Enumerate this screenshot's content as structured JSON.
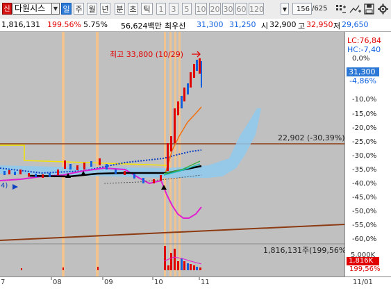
{
  "toolbar": {
    "badge": "신",
    "stock_name": "다원시스",
    "periods": [
      "일",
      "주",
      "월",
      "년",
      "분",
      "초",
      "틱"
    ],
    "active_period": "일",
    "intervals": [
      "1",
      "3",
      "5",
      "10",
      "20",
      "30",
      "60",
      "120"
    ],
    "count_value": "156",
    "count_total": "/625"
  },
  "info": {
    "volume": "1,816,131",
    "volume_ratio": "199.56%",
    "turnover": "5.75%",
    "amount": "56,624백만",
    "priority_label": "최우선",
    "ask": "31,300",
    "bid": "31,250",
    "open_label": "시",
    "open": "32,900",
    "high_label": "고",
    "high": "32,950",
    "low_label": "저",
    "low": "29,650"
  },
  "chart": {
    "high_annotation": "최고 33,800 (10/29)",
    "level_annotation": "22,902 (-30,39%)",
    "volume_annotation": "1,816,131주(199,56%)",
    "left_label": "4)"
  },
  "axis": {
    "lc": "LC:76,84",
    "hc": "HC:-7,40",
    "price_tag": "31,300",
    "price_change": "-4,86%",
    "ticks": [
      "0,0%",
      "-5,0%",
      "-10,0%",
      "-15,0%",
      "-20,0%",
      "-25,0%",
      "-30,0%",
      "-35,0%",
      "-40,0%",
      "-45,0%",
      "-50,0%",
      "-55,0%",
      "-60,0%"
    ],
    "volume_max": "5,000K",
    "volume_tag": "1,816K",
    "volume_pct": "199,56%",
    "x_labels": [
      "7",
      "08",
      "09",
      "10",
      "11",
      "11/01"
    ]
  },
  "colors": {
    "up": "#e00000",
    "down": "#1060e0",
    "accent": "#2b78d6",
    "level_line": "#8b3a12"
  }
}
